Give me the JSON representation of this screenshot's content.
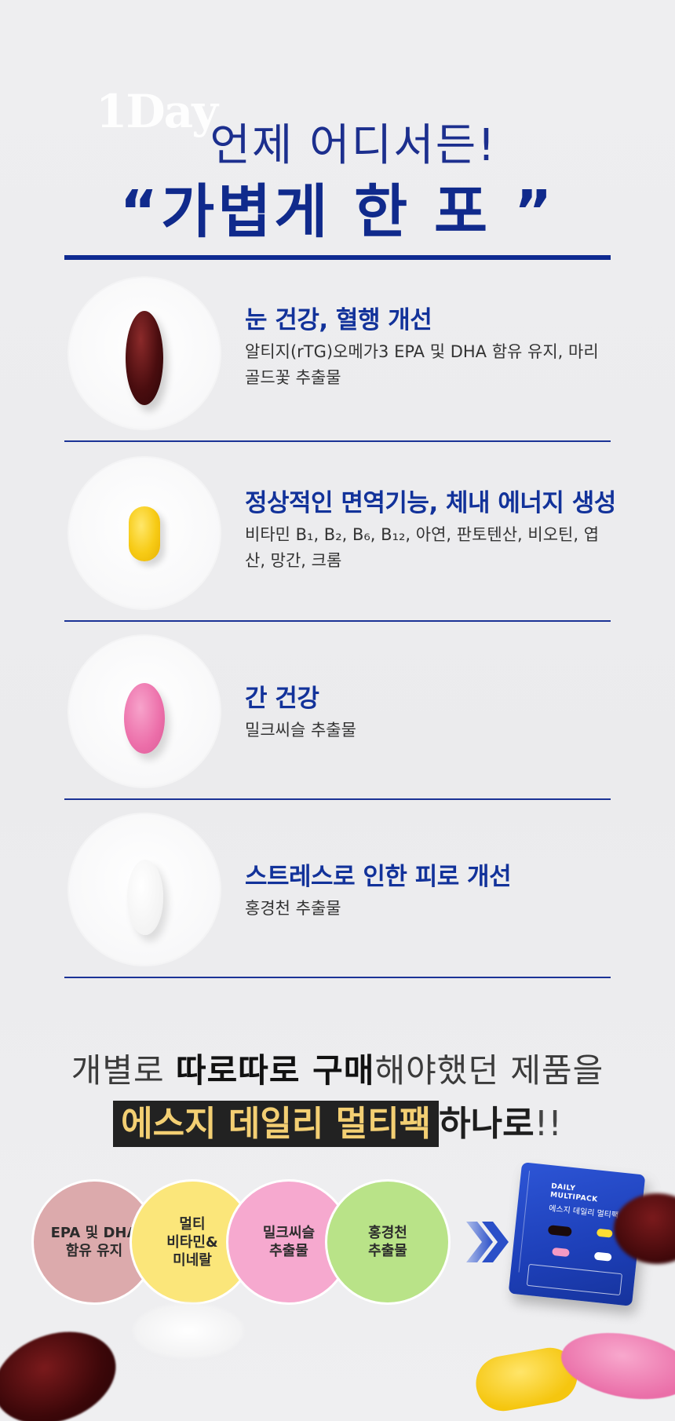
{
  "header": {
    "brand": "1Day",
    "headline_line1": "언제 어디서든!",
    "headline_line2": "“가볍게 한 포 ”"
  },
  "benefits": [
    {
      "title": "눈 건강, 혈행 개선",
      "desc": "알티지(rTG)오메가3 EPA 및 DHA 함유 유지, 마리골드꽃 추출물",
      "pill": "dark-red-softgel"
    },
    {
      "title": "정상적인 면역기능, 체내 에너지 생성",
      "desc": "비타민 B₁, B₂, B₆, B₁₂, 아연, 판토텐산, 비오틴, 엽산, 망간, 크롬",
      "pill": "yellow-capsule"
    },
    {
      "title": "간 건강",
      "desc": "밀크씨슬 추출물",
      "pill": "pink-tablet"
    },
    {
      "title": "스트레스로 인한 피로 개선",
      "desc": "홍경천 추출물",
      "pill": "white-tablet"
    }
  ],
  "middle": {
    "line1_a": "개별로 ",
    "line1_b": "따로따로 구매",
    "line1_c": "해야했던 제품을",
    "line2_highlight": "에스지 데일리 멀티팩",
    "line2_tail": "하나로",
    "line2_ex": "!!"
  },
  "circles": [
    {
      "label": "EPA 및 DHA\n함유 유지",
      "color": "#dcaaac"
    },
    {
      "label": "멀티\n비타민&\n미네랄",
      "color": "#fbe67a"
    },
    {
      "label": "밀크씨슬\n추출물",
      "color": "#f6a9cf"
    },
    {
      "label": "홍경천\n추출물",
      "color": "#b9e388"
    }
  ],
  "product": {
    "brand": "DAILY\nMULTIPACK",
    "name": "에스지 데일리 멀티팩"
  },
  "colors": {
    "accent_navy": "#12329a",
    "highlight_bg": "#222222",
    "highlight_text": "#f3cf73"
  }
}
